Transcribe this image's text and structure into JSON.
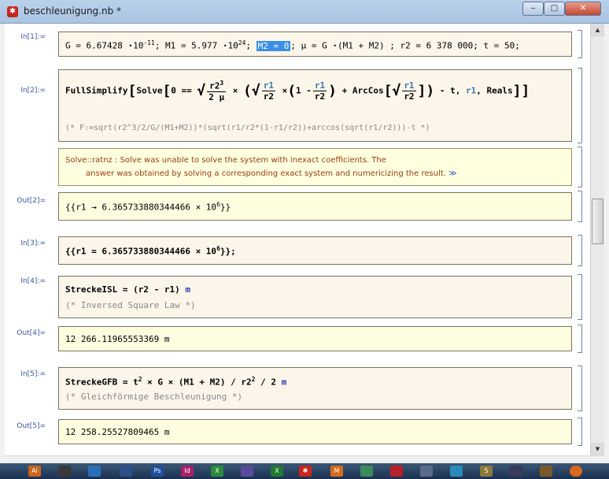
{
  "window": {
    "title": "beschleunigung.nb *",
    "min": "‒",
    "max": "□",
    "close": "✕"
  },
  "cells": {
    "in1": {
      "label": "In[1]:=",
      "a": "G = 6.67428 ",
      "b": "10",
      "bexp": "-11",
      "c": "; M1 = 5.977 ",
      "d": "10",
      "dexp": "24",
      "e": "; ",
      "sel": "M2 = 0",
      "f": "; μ = G ",
      "g": "(M1 + M2) ; r2 = 6 378 000; t = 50;"
    },
    "in2": {
      "label": "In[2]:=",
      "fs": "FullSimplify",
      "solve": "Solve",
      "zero": "0 ==",
      "r2": "r2",
      "r2exp": "3",
      "twomu": "2 μ",
      "times": "×",
      "r1": "r1",
      "r2b": "r2",
      "one": "1 -",
      "arccos": "+ ArcCos",
      "tail": "- t,",
      "r1v": "r1",
      "reals": ", Reals",
      "comment": "(*  F:=sqrt(r2^3/2/G/(M1+M2))*(sqrt(r1/r2*(1-r1/r2))+arccos(sqrt(r1/r2)))-t  *)"
    },
    "msg": {
      "line1": "Solve::ratnz :  Solve was unable to solve the system with inexact coefficients. The",
      "line2": "answer was obtained by solving a corresponding exact system and numericizing the result.",
      "more": "≫"
    },
    "out2": {
      "label": "Out[2]=",
      "pre": "{{r1 → 6.365733880344466 × 10",
      "exp": "6",
      "post": "}}"
    },
    "in3": {
      "label": "In[3]:=",
      "pre": "{{r1 = 6.365733880344466 × 10",
      "exp": "6",
      "post": "}};"
    },
    "in4": {
      "label": "In[4]:=",
      "code": "StreckeISL = (r2 - r1) ",
      "unit": "m",
      "comment": "(* Inversed Square Law *)"
    },
    "out4": {
      "label": "Out[4]=",
      "value": "12 266.11965553369 m"
    },
    "in5": {
      "label": "In[5]:=",
      "code1": "StreckeGFB = t",
      "exp1": "2",
      "code2": " × G × (M1 + M2) / r2",
      "exp2": "2",
      "code3": " / 2 ",
      "unit": "m",
      "comment": "(* Gleichförmige Beschleunigung *)"
    },
    "out5": {
      "label": "Out[5]=",
      "value": "12 258.25527809465 m"
    }
  },
  "taskbar": {
    "items": [
      "Ai",
      "Ps",
      "Id",
      "X",
      "X",
      "M",
      "S"
    ]
  }
}
